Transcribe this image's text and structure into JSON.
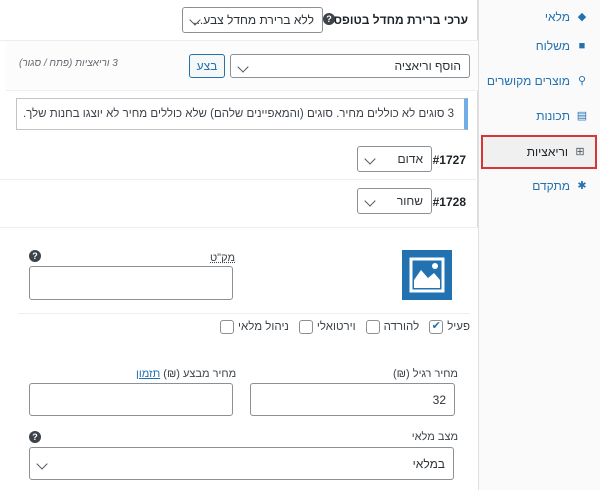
{
  "sidebar": {
    "items": [
      {
        "label": "מלאי",
        "icon": "tag-icon"
      },
      {
        "label": "משלוח",
        "icon": "truck-icon"
      },
      {
        "label": "מוצרים מקושרים",
        "icon": "link-icon"
      },
      {
        "label": "תכונות",
        "icon": "list-icon"
      },
      {
        "label": "וריאציות",
        "icon": "grid-icon"
      },
      {
        "label": "מתקדם",
        "icon": "gear-icon"
      }
    ]
  },
  "defaults": {
    "label": "ערכי ברירת מחדל בטופס:",
    "select_value": "ללא ברירת מחדל צבע..."
  },
  "actions": {
    "add_select": "הוסף וריאציה",
    "go_label": "בצע",
    "count_text": "3 וריאציות (פתח / סגור)"
  },
  "notice": "3 סוגים לא כוללים מחיר. סוגים (והמאפיינים שלהם) שלא כוללים מחיר לא יוצגו בחנות שלך.",
  "variations": [
    {
      "id": "#1727",
      "value": "אדום"
    },
    {
      "id": "#1728",
      "value": "שחור"
    }
  ],
  "details": {
    "sku_label": "מק\"ט",
    "options": [
      {
        "label": "פעיל",
        "checked": true
      },
      {
        "label": "להורדה",
        "checked": false
      },
      {
        "label": "וירטואלי",
        "checked": false
      },
      {
        "label": "ניהול מלאי",
        "checked": false
      }
    ],
    "regular_label": "מחיר רגיל (₪)",
    "regular_value": "32",
    "sale_label": "מחיר מבצע (₪)",
    "sale_link": "תזמון",
    "stock_label": "מצב מלאי",
    "stock_value": "במלאי"
  },
  "colors": {
    "accent": "#2271b1",
    "highlight": "#d63638"
  }
}
